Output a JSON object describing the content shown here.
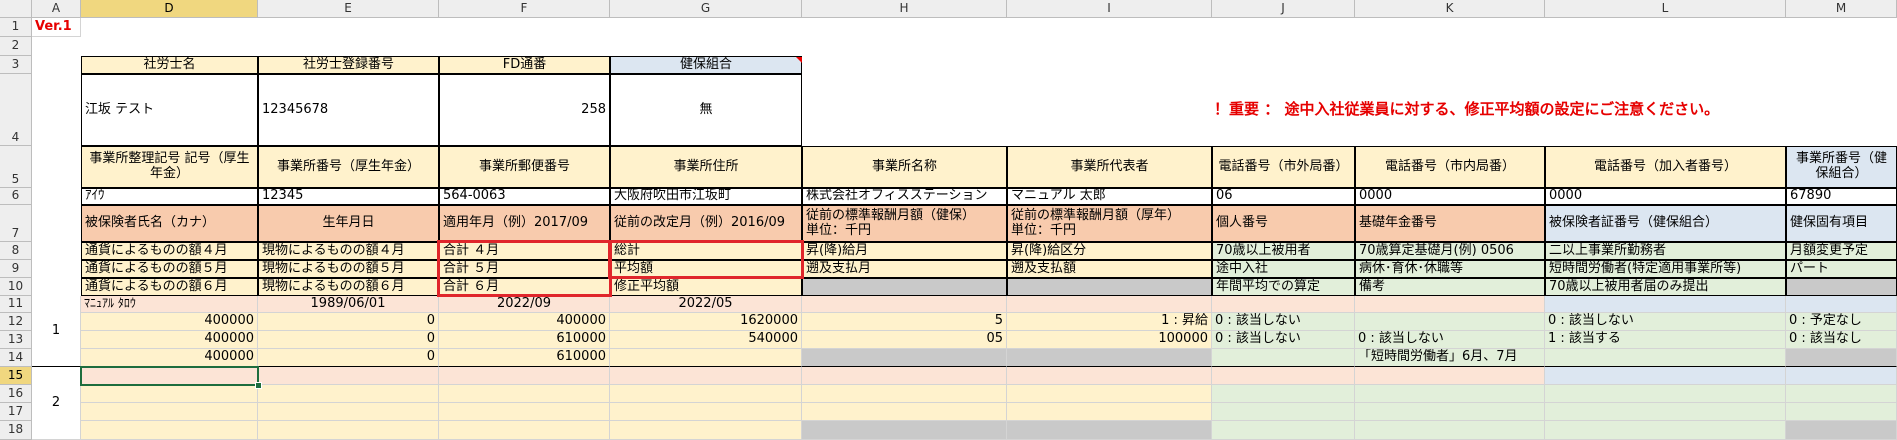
{
  "columns": [
    "A",
    "D",
    "E",
    "F",
    "G",
    "H",
    "I",
    "J",
    "K",
    "L",
    "M"
  ],
  "rows": [
    "1",
    "2",
    "3",
    "4",
    "5",
    "6",
    "7",
    "8",
    "9",
    "10",
    "11",
    "12",
    "13",
    "14",
    "15",
    "16",
    "17",
    "18"
  ],
  "version": "Ver.1",
  "header3": {
    "d": "社労士名",
    "e": "社労士登録番号",
    "f": "FD通番",
    "g": "健保組合"
  },
  "row4": {
    "d": "江坂 テスト",
    "e": "12345678",
    "f": "258",
    "g": "無",
    "notice": "！重要 ： 途中入社従業員に対する、修正平均額の設定にご注意ください。"
  },
  "row5": {
    "d": "事業所整理記号 記号（厚生年金）",
    "e": "事業所番号（厚生年金）",
    "f": "事業所郵便番号",
    "g": "事業所住所",
    "h": "事業所名称",
    "i": "事業所代表者",
    "j": "電話番号（市外局番）",
    "k": "電話番号（市内局番）",
    "l": "電話番号（加入者番号）",
    "m": "事業所番号（健保組合）"
  },
  "row6": {
    "d": "ｱｲｳ",
    "e": "12345",
    "f": "564-0063",
    "g": "大阪府吹田市江坂町",
    "h": "株式会社オフィスステーション",
    "i": "マニュアル 太郎",
    "j": "06",
    "k": "0000",
    "l": "0000",
    "m": "67890"
  },
  "row7": {
    "d": "被保険者氏名（カナ）",
    "e": "生年月日",
    "f": "適用年月（例）2017/09",
    "g": "従前の改定月（例）2016/09",
    "h1": "従前の標準報酬月額（健保）",
    "h2": "単位：千円",
    "i1": "従前の標準報酬月額（厚年）",
    "i2": "単位：千円",
    "j": "個人番号",
    "k": "基礎年金番号",
    "l": "被保険者証番号（健保組合）",
    "m": "健保固有項目"
  },
  "row8": {
    "d": "通貨によるものの額４月",
    "e": "現物によるものの額４月",
    "f": "合計 ４月",
    "g": "総計",
    "h": "昇(降)給月",
    "i": "昇(降)給区分",
    "j": "70歳以上被用者",
    "k": "70歳算定基礎月(例) 0506",
    "l": "二以上事業所勤務者",
    "m": "月額変更予定"
  },
  "row9": {
    "d": "通貨によるものの額５月",
    "e": "現物によるものの額５月",
    "f": "合計 ５月",
    "g": "平均額",
    "h": "遡及支払月",
    "i": "遡及支払額",
    "j": "途中入社",
    "k": "病休･育休･休職等",
    "l": "短時間労働者(特定適用事業所等)",
    "m": "パート"
  },
  "row10": {
    "d": "通貨によるものの額６月",
    "e": "現物によるものの額６月",
    "f": "合計 ６月",
    "g": "修正平均額",
    "j": "年間平均での算定",
    "k": "備考",
    "l": "70歳以上被用者届のみ提出"
  },
  "row11": {
    "d": "ﾏﾆｭｱﾙ ﾀﾛｳ",
    "e": "1989/06/01",
    "f": "2022/09",
    "g": "2022/05"
  },
  "group1_label": "1",
  "group2_label": "2",
  "row12": {
    "d": "400000",
    "e": "0",
    "f": "400000",
    "g": "1620000",
    "h": "5",
    "i": "1 : 昇給",
    "j": "0 : 該当しない",
    "l": "0 : 該当しない",
    "m": "0 : 予定なし"
  },
  "row13": {
    "d": "400000",
    "e": "0",
    "f": "610000",
    "g": "540000",
    "h": "05",
    "i": "100000",
    "j": "0 : 該当しない",
    "k": "0 : 該当しない",
    "l": "1 : 該当する",
    "m": "0 : 該当なし"
  },
  "row14": {
    "d": "400000",
    "e": "0",
    "f": "610000",
    "k": "「短時間労働者」6月、7月"
  }
}
